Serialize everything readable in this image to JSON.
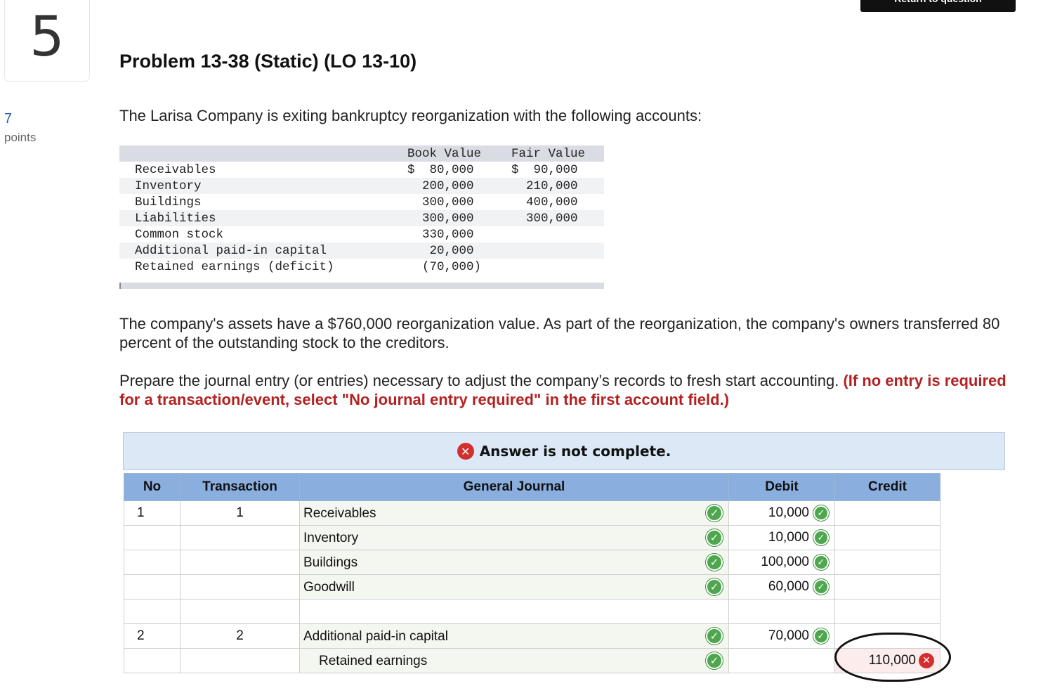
{
  "question": {
    "number": "5",
    "points_value": "7",
    "points_label": "points",
    "return_button": "Return to question",
    "title": "Problem 13-38 (Static) (LO 13-10)",
    "intro": "The Larisa Company is exiting bankruptcy reorganization with the following accounts:"
  },
  "accounts_table": {
    "headers": {
      "book_value": "Book Value",
      "fair_value": "Fair Value"
    },
    "rows": [
      {
        "name": "Receivables",
        "book": "$  80,000",
        "fair": "$  90,000"
      },
      {
        "name": "Inventory",
        "book": "  200,000",
        "fair": "  210,000"
      },
      {
        "name": "Buildings",
        "book": "  300,000",
        "fair": "  400,000"
      },
      {
        "name": "Liabilities",
        "book": "  300,000",
        "fair": "  300,000"
      },
      {
        "name": "Common stock",
        "book": "  330,000",
        "fair": ""
      },
      {
        "name": "Additional paid-in capital",
        "book": "   20,000",
        "fair": ""
      },
      {
        "name": "Retained earnings (deficit)",
        "book": "  (70,000)",
        "fair": ""
      }
    ]
  },
  "paragraph1": "The company's assets have a $760,000 reorganization value. As part of the reorganization, the company's owners transferred 80 percent of the outstanding stock to the creditors.",
  "paragraph2": {
    "text": "Prepare the journal entry (or entries) necessary to adjust the company’s records to fresh start accounting.",
    "note": "(If no entry is required for a transaction/event, select \"No journal entry required\" in the first account field.)"
  },
  "answer_status": "Answer is not complete.",
  "journal": {
    "headers": {
      "no": "No",
      "transaction": "Transaction",
      "general_journal": "General Journal",
      "debit": "Debit",
      "credit": "Credit"
    },
    "rows": [
      {
        "no": "1",
        "transaction": "1",
        "account": "Receivables",
        "debit": "10,000",
        "credit": ""
      },
      {
        "no": "",
        "transaction": "",
        "account": "Inventory",
        "debit": "10,000",
        "credit": ""
      },
      {
        "no": "",
        "transaction": "",
        "account": "Buildings",
        "debit": "100,000",
        "credit": ""
      },
      {
        "no": "",
        "transaction": "",
        "account": "Goodwill",
        "debit": "60,000",
        "credit": ""
      },
      {
        "no": "",
        "transaction": "",
        "account": "",
        "debit": "",
        "credit": ""
      },
      {
        "no": "2",
        "transaction": "2",
        "account": "Additional paid-in capital",
        "debit": "70,000",
        "credit": ""
      },
      {
        "no": "",
        "transaction": "",
        "account": "Retained earnings",
        "debit": "",
        "credit": "110,000"
      }
    ]
  },
  "icons": {
    "correct": "check-icon",
    "incorrect": "x-icon"
  },
  "colors": {
    "note_red": "#b32222",
    "header_blue": "#8aafdf",
    "banner_blue": "#dce8f6",
    "check_green": "#4ea64e",
    "error_red": "#d32f2f"
  }
}
